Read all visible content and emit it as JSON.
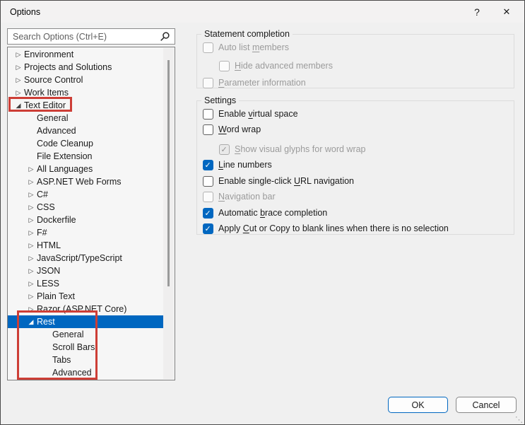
{
  "window": {
    "title": "Options",
    "help_label": "?",
    "close_label": "✕"
  },
  "search": {
    "placeholder": "Search Options (Ctrl+E)"
  },
  "tree": {
    "items": [
      {
        "label": "Environment",
        "glyph": "▷",
        "level": 0,
        "state": "collapsed",
        "selected": false
      },
      {
        "label": "Projects and Solutions",
        "glyph": "▷",
        "level": 0,
        "state": "collapsed",
        "selected": false
      },
      {
        "label": "Source Control",
        "glyph": "▷",
        "level": 0,
        "state": "collapsed",
        "selected": false
      },
      {
        "label": "Work Items",
        "glyph": "▷",
        "level": 0,
        "state": "collapsed",
        "selected": false
      },
      {
        "label": "Text Editor",
        "glyph": "◢",
        "level": 0,
        "state": "expanded",
        "selected": false
      },
      {
        "label": "General",
        "glyph": "",
        "level": 1,
        "state": "leaf",
        "selected": false
      },
      {
        "label": "Advanced",
        "glyph": "",
        "level": 1,
        "state": "leaf",
        "selected": false
      },
      {
        "label": "Code Cleanup",
        "glyph": "",
        "level": 1,
        "state": "leaf",
        "selected": false
      },
      {
        "label": "File Extension",
        "glyph": "",
        "level": 1,
        "state": "leaf",
        "selected": false
      },
      {
        "label": "All Languages",
        "glyph": "▷",
        "level": 1,
        "state": "collapsed",
        "selected": false
      },
      {
        "label": "ASP.NET Web Forms",
        "glyph": "▷",
        "level": 1,
        "state": "collapsed",
        "selected": false
      },
      {
        "label": "C#",
        "glyph": "▷",
        "level": 1,
        "state": "collapsed",
        "selected": false
      },
      {
        "label": "CSS",
        "glyph": "▷",
        "level": 1,
        "state": "collapsed",
        "selected": false
      },
      {
        "label": "Dockerfile",
        "glyph": "▷",
        "level": 1,
        "state": "collapsed",
        "selected": false
      },
      {
        "label": "F#",
        "glyph": "▷",
        "level": 1,
        "state": "collapsed",
        "selected": false
      },
      {
        "label": "HTML",
        "glyph": "▷",
        "level": 1,
        "state": "collapsed",
        "selected": false
      },
      {
        "label": "JavaScript/TypeScript",
        "glyph": "▷",
        "level": 1,
        "state": "collapsed",
        "selected": false
      },
      {
        "label": "JSON",
        "glyph": "▷",
        "level": 1,
        "state": "collapsed",
        "selected": false
      },
      {
        "label": "LESS",
        "glyph": "▷",
        "level": 1,
        "state": "collapsed",
        "selected": false
      },
      {
        "label": "Plain Text",
        "glyph": "▷",
        "level": 1,
        "state": "collapsed",
        "selected": false
      },
      {
        "label": "Razor (ASP.NET Core)",
        "glyph": "▷",
        "level": 1,
        "state": "collapsed",
        "selected": false
      },
      {
        "label": "Rest",
        "glyph": "◢",
        "level": 1,
        "state": "expanded",
        "selected": true
      },
      {
        "label": "General",
        "glyph": "",
        "level": 2,
        "state": "leaf",
        "selected": false
      },
      {
        "label": "Scroll Bars",
        "glyph": "",
        "level": 2,
        "state": "leaf",
        "selected": false
      },
      {
        "label": "Tabs",
        "glyph": "",
        "level": 2,
        "state": "leaf",
        "selected": false
      },
      {
        "label": "Advanced",
        "glyph": "",
        "level": 2,
        "state": "leaf",
        "selected": false
      }
    ]
  },
  "groups": {
    "statement_completion": {
      "title": "Statement completion",
      "items": [
        {
          "pre": "Auto list ",
          "key": "m",
          "post": "embers",
          "checked": false,
          "enabled": false
        },
        {
          "pre": "",
          "key": "H",
          "post": "ide advanced members",
          "checked": false,
          "enabled": false
        },
        {
          "pre": "",
          "key": "P",
          "post": "arameter information",
          "checked": false,
          "enabled": false
        }
      ]
    },
    "settings": {
      "title": "Settings",
      "items": [
        {
          "pre": "Enable ",
          "key": "v",
          "post": "irtual space",
          "checked": false,
          "enabled": true
        },
        {
          "pre": "",
          "key": "W",
          "post": "ord wrap",
          "checked": false,
          "enabled": true
        },
        {
          "pre": "",
          "key": "S",
          "post": "how visual glyphs for word wrap",
          "checked": true,
          "enabled": false
        },
        {
          "pre": "",
          "key": "L",
          "post": "ine numbers",
          "checked": true,
          "enabled": true
        },
        {
          "pre": "Enable single-click ",
          "key": "U",
          "post": "RL navigation",
          "checked": false,
          "enabled": true
        },
        {
          "pre": "",
          "key": "N",
          "post": "avigation bar",
          "checked": false,
          "enabled": false
        },
        {
          "pre": "Automatic ",
          "key": "b",
          "post": "race completion",
          "checked": true,
          "enabled": true
        },
        {
          "pre": "Apply ",
          "key": "C",
          "post": "ut or Copy to blank lines when there is no selection",
          "checked": true,
          "enabled": true
        }
      ]
    }
  },
  "footer": {
    "ok_label": "OK",
    "cancel_label": "Cancel"
  },
  "colors": {
    "accent": "#0067c0",
    "selection": "#0067c0",
    "annotation_red": "#cd3e36"
  }
}
